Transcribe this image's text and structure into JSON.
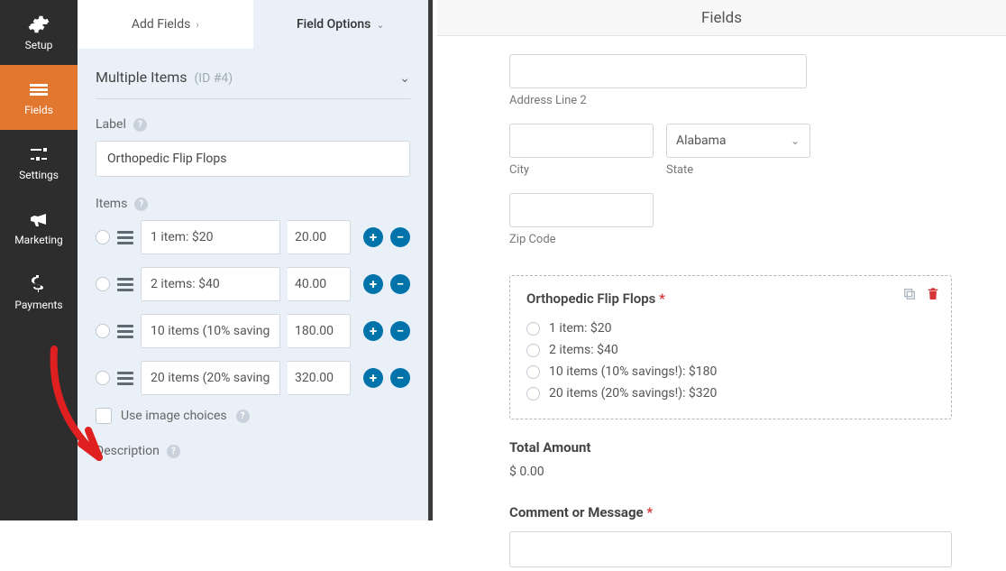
{
  "nav": [
    {
      "label": "Setup"
    },
    {
      "label": "Fields"
    },
    {
      "label": "Settings"
    },
    {
      "label": "Marketing"
    },
    {
      "label": "Payments"
    }
  ],
  "tabs": {
    "add": "Add Fields",
    "opts": "Field Options"
  },
  "header": {
    "title": "Multiple Items",
    "id": "(ID #4)"
  },
  "labelSection": {
    "label": "Label",
    "value": "Orthopedic Flip Flops"
  },
  "itemsSection": {
    "label": "Items",
    "rows": [
      {
        "name": "1 item: $20",
        "price": "20.00"
      },
      {
        "name": "2 items: $40",
        "price": "40.00"
      },
      {
        "name": "10 items (10% savings!): $180",
        "price": "180.00"
      },
      {
        "name": "20 items (20% savings!): $320",
        "price": "320.00"
      }
    ]
  },
  "imageChoices": "Use image choices",
  "descLabel": "Description",
  "rightHeader": "Fields",
  "address": {
    "line2Label": "Address Line 2",
    "cityLabel": "City",
    "stateLabel": "State",
    "stateValue": "Alabama",
    "zipLabel": "Zip Code"
  },
  "preview": {
    "title": "Orthopedic Flip Flops",
    "opts": [
      "1 item: $20",
      "2 items: $40",
      "10 items (10% savings!): $180",
      "20 items (20% savings!): $320"
    ]
  },
  "total": {
    "label": "Total Amount",
    "value": "$ 0.00"
  },
  "comment": {
    "label": "Comment or Message"
  }
}
